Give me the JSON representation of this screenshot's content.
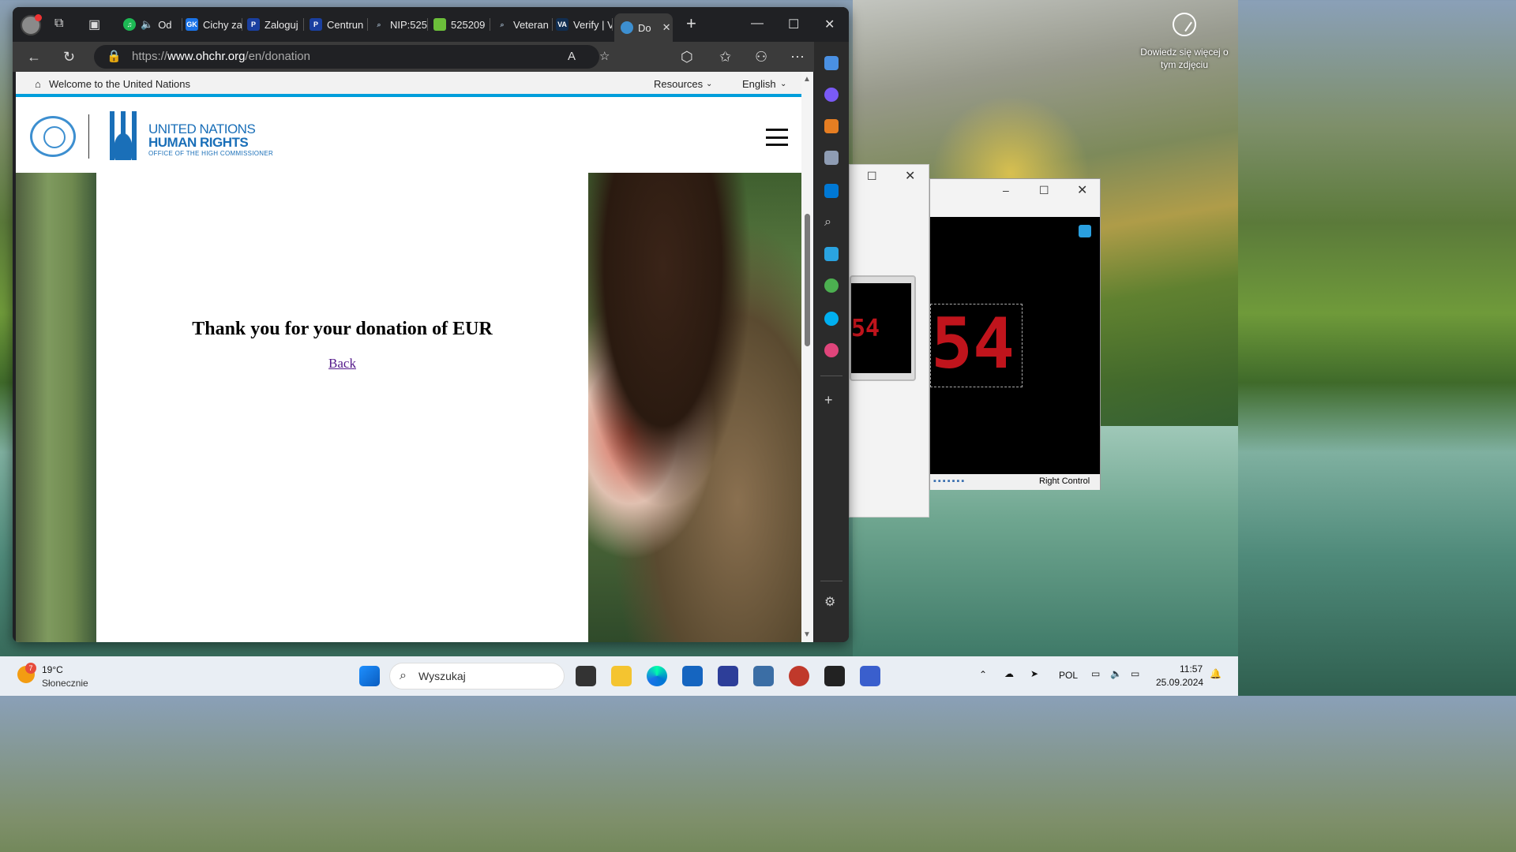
{
  "desktop": {
    "info_line1": "Dowiedz się więcej o",
    "info_line2": "tym zdjęciu"
  },
  "browser": {
    "tabs": [
      {
        "label": "Od",
        "favicon": "spotify-icon",
        "color": "#1db954"
      },
      {
        "label": "Cichy za",
        "favicon": "GK",
        "color": "#1a73e8"
      },
      {
        "label": "Zaloguj",
        "favicon": "P",
        "color": "#1a3fa0"
      },
      {
        "label": "Centrun",
        "favicon": "P",
        "color": "#1a3fa0"
      },
      {
        "label": "NIP:525",
        "favicon": "search-icon",
        "color": "#666"
      },
      {
        "label": "525209",
        "favicon": "leaf-icon",
        "color": "#6cbf3a"
      },
      {
        "label": "Veteran",
        "favicon": "search-icon",
        "color": "#666"
      },
      {
        "label": "Verify | V",
        "favicon": "VA",
        "color": "#112e51"
      },
      {
        "label": "Do",
        "favicon": "un-icon",
        "color": "#3d8fd0",
        "active": true
      }
    ],
    "url_prefix": "https://",
    "url_domain": "www.ohchr.org",
    "url_path": "/en/donation"
  },
  "page": {
    "topbar_welcome": "Welcome to the United Nations",
    "topbar_resources": "Resources",
    "topbar_language": "English",
    "logo_line1": "UNITED NATIONS",
    "logo_line2": "HUMAN RIGHTS",
    "logo_line3": "OFFICE OF THE HIGH COMMISSIONER",
    "thanks_message": "Thank you for your donation of EUR",
    "back_link": "Back"
  },
  "vm_window": {
    "display_value": "54",
    "status_text": "Right Control"
  },
  "taskbar": {
    "weather_temp": "19°C",
    "weather_desc": "Słonecznie",
    "weather_badge": "7",
    "search_placeholder": "Wyszukaj",
    "language": "POL",
    "time": "11:57",
    "date": "25.09.2024"
  }
}
